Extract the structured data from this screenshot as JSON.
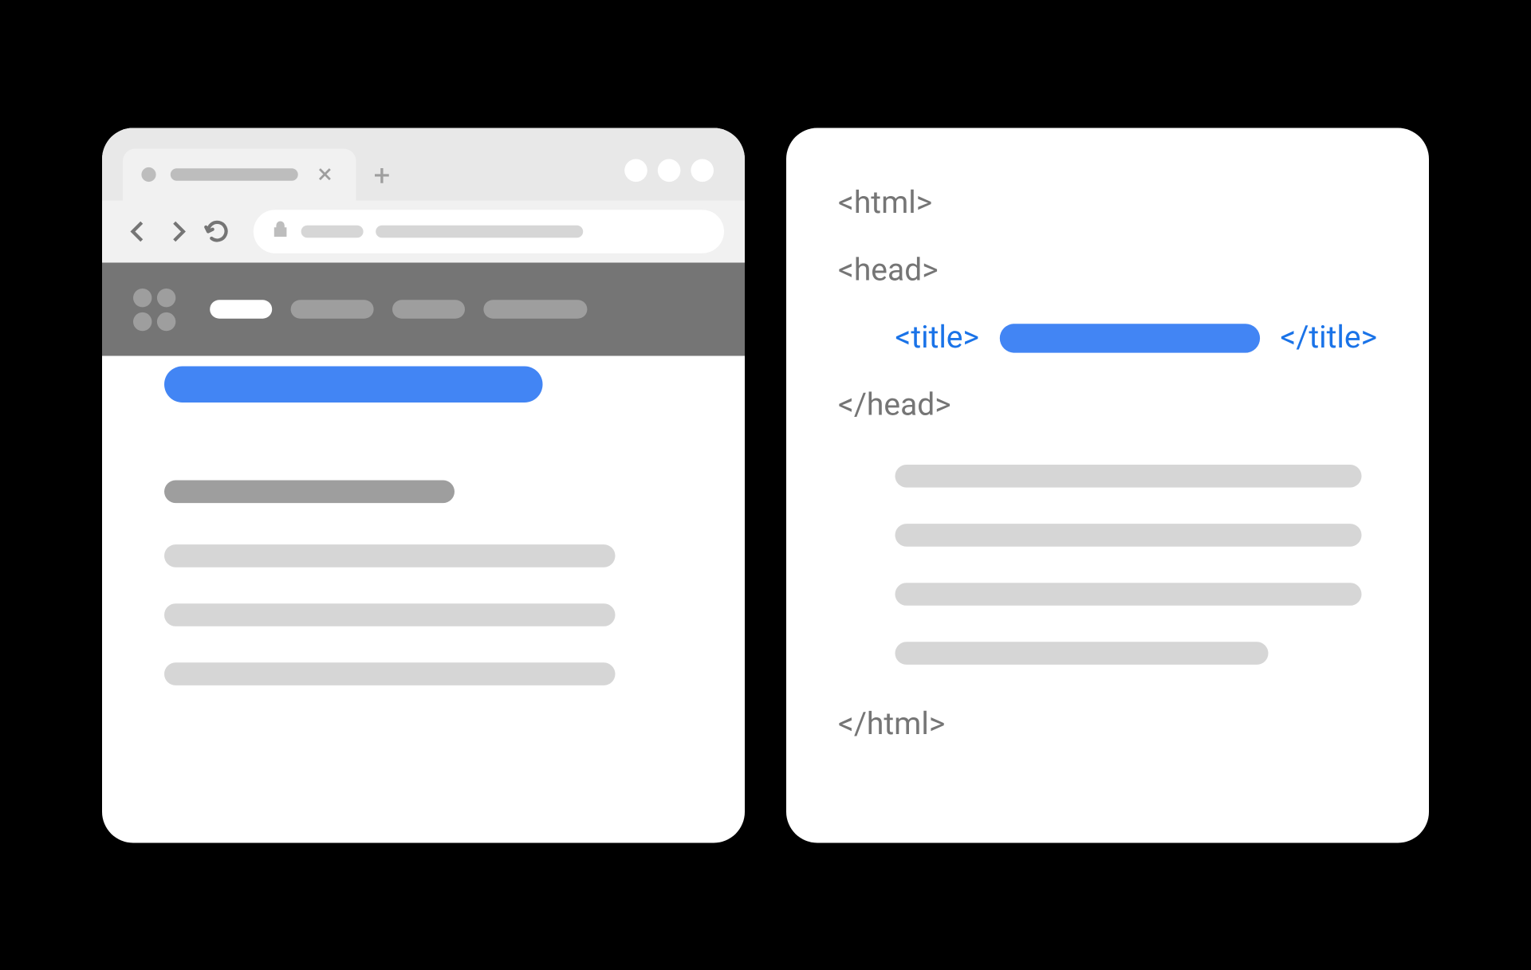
{
  "code": {
    "html_open": "<html>",
    "head_open": "<head>",
    "title_open": "<title>",
    "title_close": "</title>",
    "head_close": "</head>",
    "html_close": "</html>"
  },
  "colors": {
    "blue": "#4285f4",
    "darkblue": "#1a73e8",
    "gray_text": "#757575",
    "gray_medium": "#9e9e9e",
    "gray_light": "#d6d6d6",
    "gray_lighter": "#e8e8e8",
    "gray_lightest": "#f1f1f1"
  }
}
